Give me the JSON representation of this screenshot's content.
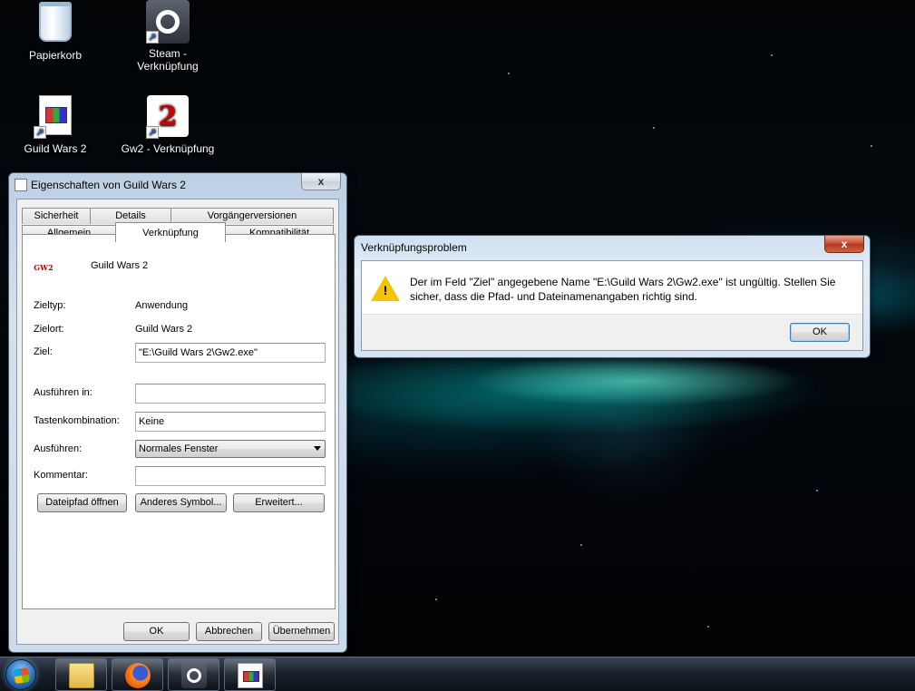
{
  "desktop": {
    "icons": [
      {
        "label": "Papierkorb",
        "icon": "recycle-bin-icon"
      },
      {
        "label": "Steam - Verknüpfung",
        "icon": "steam-icon"
      },
      {
        "label": "Guild Wars 2",
        "icon": "document-shortcut-icon"
      },
      {
        "label": "Gw2 - Verknüpfung",
        "icon": "gw2-dragon-icon"
      }
    ]
  },
  "properties": {
    "title": "Eigenschaften von Guild Wars 2",
    "close": "x",
    "tabs_top": [
      "Sicherheit",
      "Details",
      "Vorgängerversionen"
    ],
    "tabs_bottom": [
      "Allgemein",
      "Verknüpfung",
      "Kompatibilität"
    ],
    "active_tab": "Verknüpfung",
    "app_name": "Guild Wars 2",
    "zieltyp_label": "Zieltyp:",
    "zieltyp_value": "Anwendung",
    "zielort_label": "Zielort:",
    "zielort_value": "Guild Wars 2",
    "ziel_label": "Ziel:",
    "ziel_value": "\"E:\\Guild Wars 2\\Gw2.exe\"",
    "ausfuehren_in_label": "Ausführen in:",
    "ausfuehren_in_value": "",
    "tasten_label": "Tastenkombination:",
    "tasten_value": "Keine",
    "ausfuehren_label": "Ausführen:",
    "ausfuehren_value": "Normales Fenster",
    "kommentar_label": "Kommentar:",
    "kommentar_value": "",
    "btn_dateipfad": "Dateipfad öffnen",
    "btn_symbol": "Anderes Symbol...",
    "btn_erweitert": "Erweitert...",
    "btn_ok": "OK",
    "btn_abbrechen": "Abbrechen",
    "btn_uebernehmen": "Übernehmen"
  },
  "error_dialog": {
    "title": "Verknüpfungsproblem",
    "close": "x",
    "message": "Der im Feld \"Ziel\" angegebene Name \"E:\\Guild Wars 2\\Gw2.exe\" ist ungültig. Stellen Sie sicher, dass die Pfad- und Dateinamenangaben richtig sind.",
    "ok": "OK",
    "icon": "warning-icon"
  },
  "taskbar": {
    "items": [
      "start-orb-icon",
      "explorer-folder-icon",
      "firefox-icon",
      "steam-icon",
      "shortcut-document-icon"
    ]
  }
}
